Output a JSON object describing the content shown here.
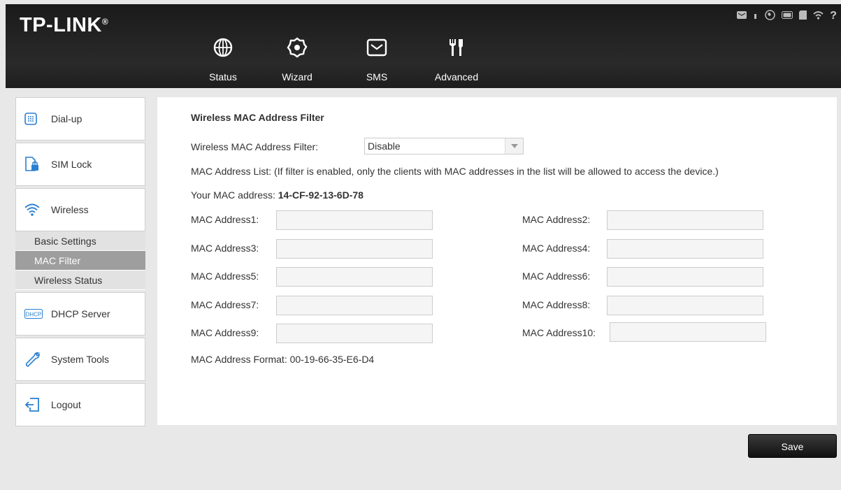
{
  "header": {
    "logo": "TP-LINK",
    "logo_mark": "®",
    "nav": [
      {
        "label": "Status",
        "icon": "globe-icon"
      },
      {
        "label": "Wizard",
        "icon": "gear-icon"
      },
      {
        "label": "SMS",
        "icon": "envelope-icon"
      },
      {
        "label": "Advanced",
        "icon": "tools-icon"
      }
    ],
    "status_icons": [
      "sms-indicator-icon",
      "signal-icon",
      "internet-icon",
      "battery-icon",
      "sd-card-icon",
      "wifi-icon",
      "help-icon"
    ]
  },
  "sidebar": {
    "items": [
      {
        "label": "Dial-up",
        "icon": "dialpad-icon"
      },
      {
        "label": "SIM Lock",
        "icon": "sim-lock-icon"
      },
      {
        "label": "Wireless",
        "icon": "wireless-icon"
      },
      {
        "label": "DHCP Server",
        "icon": "dhcp-icon"
      },
      {
        "label": "System Tools",
        "icon": "wrench-icon"
      },
      {
        "label": "Logout",
        "icon": "logout-icon"
      }
    ],
    "wireless_sub": [
      {
        "label": "Basic Settings",
        "active": false
      },
      {
        "label": "MAC Filter",
        "active": true
      },
      {
        "label": "Wireless Status",
        "active": false
      }
    ]
  },
  "main": {
    "title": "Wireless MAC Address Filter",
    "filter_label": "Wireless MAC Address Filter:",
    "filter_value": "Disable",
    "list_note": "MAC Address List: (If filter is enabled, only the clients with MAC addresses in the list will be allowed to access the device.)",
    "your_mac_label": "Your MAC address:",
    "your_mac_value": "14-CF-92-13-6D-78",
    "addresses": [
      {
        "label": "MAC Address1:",
        "value": ""
      },
      {
        "label": "MAC Address2:",
        "value": ""
      },
      {
        "label": "MAC Address3:",
        "value": ""
      },
      {
        "label": "MAC Address4:",
        "value": ""
      },
      {
        "label": "MAC Address5:",
        "value": ""
      },
      {
        "label": "MAC Address6:",
        "value": ""
      },
      {
        "label": "MAC Address7:",
        "value": ""
      },
      {
        "label": "MAC Address8:",
        "value": ""
      },
      {
        "label": "MAC Address9:",
        "value": ""
      },
      {
        "label": "MAC Address10:",
        "value": ""
      }
    ],
    "format_note": "MAC Address Format: 00-19-66-35-E6-D4"
  },
  "save_label": "Save"
}
